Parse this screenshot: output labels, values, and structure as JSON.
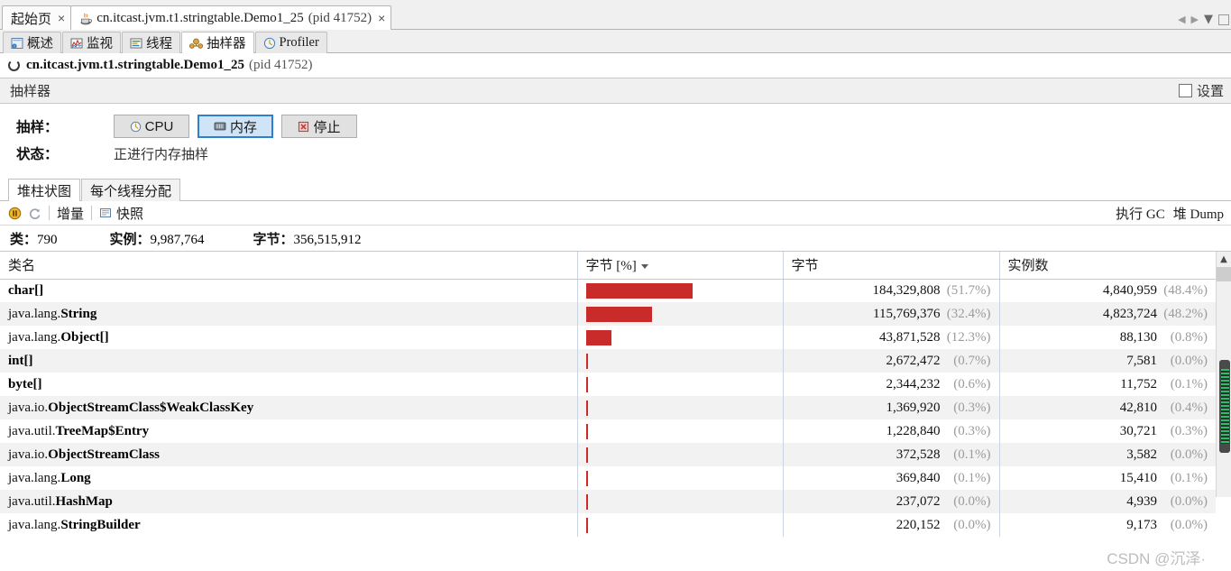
{
  "window": {
    "tabs": [
      {
        "label": "起始页",
        "closable": true,
        "icon": null,
        "active": false
      },
      {
        "label": "cn.itcast.jvm.t1.stringtable.Demo1_25",
        "suffix": "(pid 41752)",
        "closable": true,
        "icon": "java-coffee-icon",
        "active": true
      }
    ],
    "nav": {
      "prev_icon": "triangle-left-icon",
      "next_icon": "triangle-right-icon",
      "dropdown_icon": "chevron-down-icon",
      "maximize_icon": "square-icon"
    }
  },
  "subtabs": [
    {
      "label": "概述",
      "icon": "overview-icon",
      "active": false
    },
    {
      "label": "监视",
      "icon": "monitor-chart-icon",
      "active": false
    },
    {
      "label": "线程",
      "icon": "threads-icon",
      "active": false
    },
    {
      "label": "抽样器",
      "icon": "sampler-icon",
      "active": true
    },
    {
      "label": "Profiler",
      "icon": "clock-icon",
      "active": false
    }
  ],
  "app_header": {
    "status_icon": "loading-spinner-icon",
    "name": "cn.itcast.jvm.t1.stringtable.Demo1_25",
    "pid": "(pid 41752)"
  },
  "sampler_bar": {
    "title": "抽样器",
    "settings_label": "设置",
    "settings_checked": false
  },
  "sample_controls": {
    "sample_label": "抽样：",
    "buttons": [
      {
        "label": "CPU",
        "icon": "clock-icon",
        "selected": false
      },
      {
        "label": "内存",
        "icon": "memory-icon",
        "selected": true
      },
      {
        "label": "停止",
        "icon": "stop-red-x-icon",
        "selected": false
      }
    ],
    "state_label": "状态：",
    "state_value": "正进行内存抽样"
  },
  "lower_tabs": [
    {
      "label": "堆柱状图",
      "active": true
    },
    {
      "label": "每个线程分配",
      "active": false
    }
  ],
  "mini_toolbar": {
    "pause_icon": "pause-icon",
    "refresh_icon": "refresh-icon",
    "delta_label": "增量",
    "snapshot_icon": "snapshot-icon",
    "snapshot_label": "快照",
    "right_actions": [
      "执行 GC",
      "堆 Dump"
    ]
  },
  "summary": {
    "classes_label": "类：",
    "classes_value": "790",
    "instances_label": "实例：",
    "instances_value": "9,987,764",
    "bytes_label": "字节：",
    "bytes_value": "356,515,912"
  },
  "table": {
    "columns": [
      {
        "key": "name",
        "label": "类名",
        "sorted": false
      },
      {
        "key": "bytes_pct_bar",
        "label": "字节 [%]",
        "sorted": true,
        "sort_dir": "desc"
      },
      {
        "key": "bytes",
        "label": "字节",
        "sorted": false
      },
      {
        "key": "instances",
        "label": "实例数",
        "sorted": false
      }
    ],
    "rows": [
      {
        "pkg": "",
        "cls": "char[]",
        "bar_pct": 51.7,
        "bytes": "184,329,808",
        "bytes_pct": "(51.7%)",
        "instances": "4,840,959",
        "instances_pct": "(48.4%)"
      },
      {
        "pkg": "java.lang.",
        "cls": "String",
        "bar_pct": 32.4,
        "bytes": "115,769,376",
        "bytes_pct": "(32.4%)",
        "instances": "4,823,724",
        "instances_pct": "(48.2%)"
      },
      {
        "pkg": "java.lang.",
        "cls": "Object[]",
        "bar_pct": 12.3,
        "bytes": "43,871,528",
        "bytes_pct": "(12.3%)",
        "instances": "88,130",
        "instances_pct": "(0.8%)"
      },
      {
        "pkg": "",
        "cls": "int[]",
        "bar_pct": 0.7,
        "bytes": "2,672,472",
        "bytes_pct": "(0.7%)",
        "instances": "7,581",
        "instances_pct": "(0.0%)"
      },
      {
        "pkg": "",
        "cls": "byte[]",
        "bar_pct": 0.6,
        "bytes": "2,344,232",
        "bytes_pct": "(0.6%)",
        "instances": "11,752",
        "instances_pct": "(0.1%)"
      },
      {
        "pkg": "java.io.",
        "cls": "ObjectStreamClass$WeakClassKey",
        "bar_pct": 0.3,
        "bytes": "1,369,920",
        "bytes_pct": "(0.3%)",
        "instances": "42,810",
        "instances_pct": "(0.4%)"
      },
      {
        "pkg": "java.util.",
        "cls": "TreeMap$Entry",
        "bar_pct": 0.3,
        "bytes": "1,228,840",
        "bytes_pct": "(0.3%)",
        "instances": "30,721",
        "instances_pct": "(0.3%)"
      },
      {
        "pkg": "java.io.",
        "cls": "ObjectStreamClass",
        "bar_pct": 0.1,
        "bytes": "372,528",
        "bytes_pct": "(0.1%)",
        "instances": "3,582",
        "instances_pct": "(0.0%)"
      },
      {
        "pkg": "java.lang.",
        "cls": "Long",
        "bar_pct": 0.1,
        "bytes": "369,840",
        "bytes_pct": "(0.1%)",
        "instances": "15,410",
        "instances_pct": "(0.1%)"
      },
      {
        "pkg": "java.util.",
        "cls": "HashMap",
        "bar_pct": 0.0,
        "bytes": "237,072",
        "bytes_pct": "(0.0%)",
        "instances": "4,939",
        "instances_pct": "(0.0%)"
      },
      {
        "pkg": "java.lang.",
        "cls": "StringBuilder",
        "bar_pct": 0.0,
        "bytes": "220,152",
        "bytes_pct": "(0.0%)",
        "instances": "9,173",
        "instances_pct": "(0.0%)"
      }
    ]
  },
  "watermark": "CSDN @沉泽·",
  "colors": {
    "bar_red": "#c92b2b",
    "selected_button_bg": "#cfe4f7",
    "selected_button_border": "#2f7fd1",
    "percent_gray": "#9b9b9b"
  }
}
